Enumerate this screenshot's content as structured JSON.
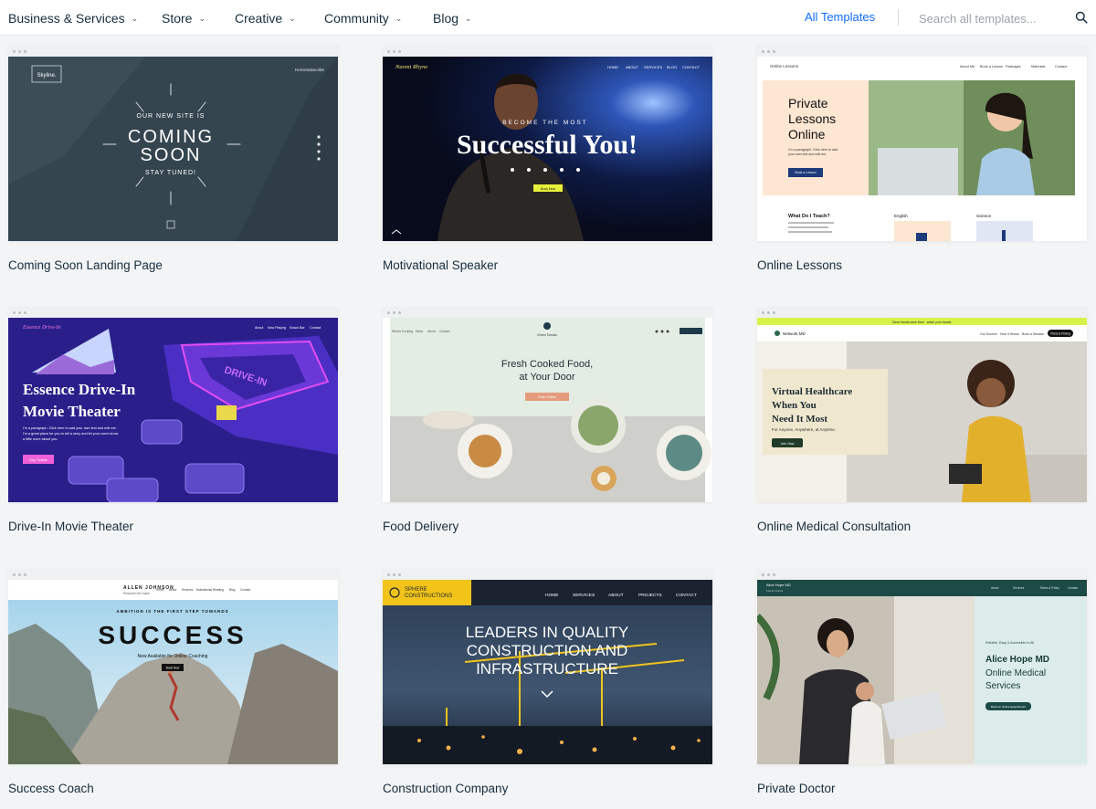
{
  "nav": {
    "items": [
      {
        "label": "Business & Services"
      },
      {
        "label": "Store"
      },
      {
        "label": "Creative"
      },
      {
        "label": "Community"
      },
      {
        "label": "Blog"
      }
    ],
    "all_templates": "All Templates",
    "search_placeholder": "Search all templates..."
  },
  "templates": [
    {
      "title": "Coming Soon Landing Page",
      "preview": {
        "brand": "Skyline.",
        "links": [
          "Home",
          "Subscribe"
        ],
        "eyebrow": "OUR NEW SITE IS",
        "headline": [
          "COMING",
          "SOON"
        ],
        "tagline": "STAY TUNED!"
      }
    },
    {
      "title": "Motivational Speaker",
      "preview": {
        "brand": "Naomi Rhyne",
        "links": [
          "HOME",
          "ABOUT",
          "SERVICES",
          "BLOG",
          "CONTACT"
        ],
        "eyebrow": "BECOME THE MOST",
        "headline": "Successful You!",
        "cta": "Book Now"
      }
    },
    {
      "title": "Online Lessons",
      "preview": {
        "brand": "Online Lessons",
        "links": [
          "About Me",
          "Book a Lesson",
          "Packages",
          "Materials",
          "Contact"
        ],
        "headline": [
          "Private",
          "Lessons",
          "Online"
        ],
        "body": [
          "I'm a paragraph. Click here to add",
          "your own text and edit me."
        ],
        "cta": "Book a Lesson",
        "section": "What Do I Teach?",
        "subjects": [
          "English",
          "Science"
        ]
      }
    },
    {
      "title": "Drive-In Movie Theater",
      "preview": {
        "brand": "Essence Drive-In",
        "links": [
          "About",
          "Now Playing",
          "Snack Bar",
          "Contact"
        ],
        "headline": [
          "Essence Drive-In",
          "Movie Theater"
        ],
        "body": [
          "I'm a paragraph. Click here to add your own text and edit me.",
          "I'm a great place for you to tell a story and let your users know",
          "a little more about you."
        ],
        "cta": "Buy Tickets",
        "sign": "DRIVE-IN"
      }
    },
    {
      "title": "Food Delivery",
      "preview": {
        "brand": "Green Tomato",
        "links": [
          "What's Cooking",
          "Menu",
          "About",
          "Contact"
        ],
        "headline": [
          "Fresh Cooked Food,",
          "at Your Door"
        ],
        "cta": "Order Online"
      }
    },
    {
      "title": "Online Medical Consultation",
      "preview": {
        "banner": "Clear hands save lives · wash your hands",
        "brand": "Network MD",
        "links": [
          "Our Doctors",
          "How It Works",
          "Book a Session"
        ],
        "nav_cta": "Plans & Pricing",
        "headline": [
          "Virtual Healthcare",
          "When You",
          "Need It Most"
        ],
        "subline": "For Anyone, Anywhere, at Anytime.",
        "cta": "Join Now"
      }
    },
    {
      "title": "Success Coach",
      "preview": {
        "brand": "ALLEN JOHNSON",
        "subbrand": "Personal Life Coach",
        "links": [
          "Home",
          "About",
          "Services",
          "Motivational Reading",
          "Blog",
          "Contact"
        ],
        "eyebrow": "AMBITION IS THE FIRST STEP TOWARDS",
        "headline": "SUCCESS",
        "subline": "Now Available for Online Coaching",
        "cta": "Book Now"
      }
    },
    {
      "title": "Construction Company",
      "preview": {
        "brand": [
          "SPHERE",
          "CONSTRUCTIONS"
        ],
        "links": [
          "HOME",
          "SERVICES",
          "ABOUT",
          "PROJECTS",
          "CONTACT"
        ],
        "headline": [
          "LEADERS IN QUALITY",
          "CONSTRUCTION AND",
          "INFRASTRUCTURE"
        ]
      }
    },
    {
      "title": "Private Doctor",
      "preview": {
        "brand": "Alice Hope MD",
        "subbrand": "Family Doctor",
        "links": [
          "About",
          "Services",
          "Rates & Policy",
          "Contact"
        ],
        "eyebrow": "Reliable, Easy & Accessible to All",
        "name": "Alice Hope MD",
        "headline": [
          "Online Medical",
          "Services"
        ],
        "cta": "Book an Online Appointment"
      }
    }
  ],
  "colors": {
    "accent": "#116dff",
    "page_bg": "#f3f4f5",
    "text": "#162d3d"
  }
}
